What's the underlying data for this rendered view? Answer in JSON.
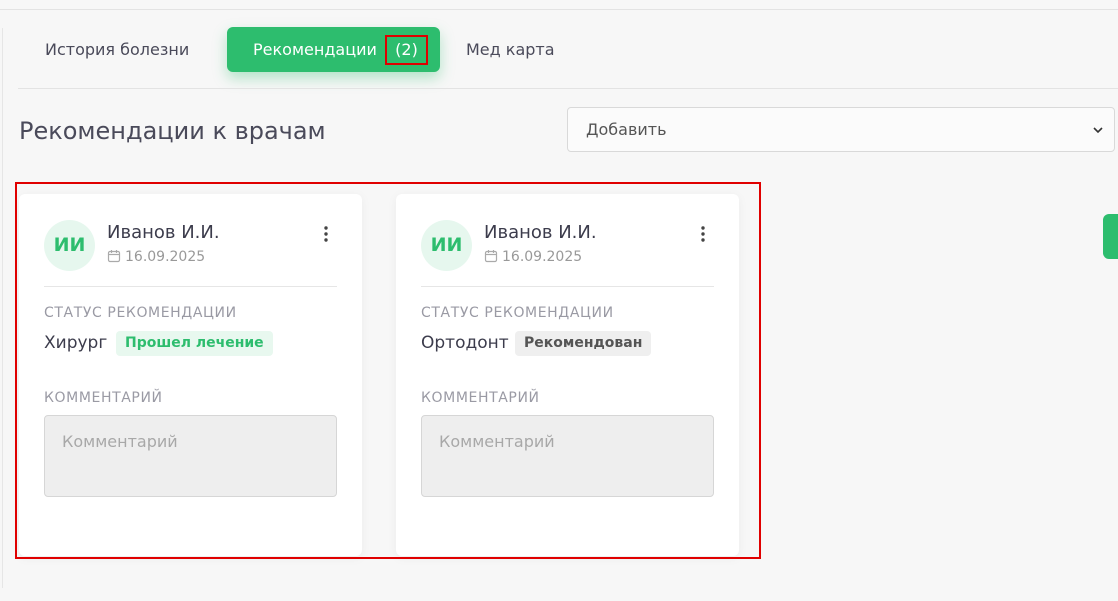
{
  "tabs": {
    "history_label": "История болезни",
    "recs_label": "Рекомендации",
    "recs_count": "(2)",
    "med_label": "Мед карта"
  },
  "section": {
    "title": "Рекомендации к врачам",
    "add_placeholder": "Добавить"
  },
  "labels": {
    "status": "СТАТУС РЕКОМЕНДАЦИИ",
    "comment": "КОММЕНТАРИЙ",
    "comment_placeholder": "Комментарий"
  },
  "cards": [
    {
      "initials": "ИИ",
      "name": "Иванов И.И.",
      "date": "16.09.2025",
      "specialty": "Хирург",
      "status": "Прошел лечение",
      "status_color": "#2dbd6e"
    },
    {
      "initials": "ИИ",
      "name": "Иванов И.И.",
      "date": "16.09.2025",
      "specialty": "Ортодонт",
      "status": "Рекомендован",
      "status_color": "#555555"
    }
  ],
  "colors": {
    "accent": "#2dbd6e",
    "highlight": "#e00000"
  }
}
